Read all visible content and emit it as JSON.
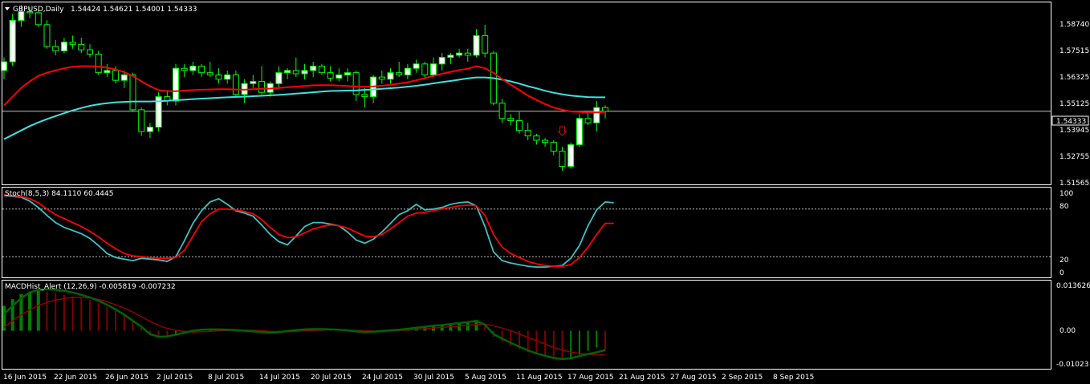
{
  "colors": {
    "background": "#000000",
    "frame": "#ffffff",
    "bull_fill": "#ffffff",
    "candle_outline": "#00ff00",
    "ma_red": "#ff0000",
    "ma_cyan": "#40e0e0",
    "stoch_main": "#40c0c0",
    "stoch_signal": "#ff0000",
    "macd_up": "#008000",
    "macd_down": "#800000",
    "macd_line": "#006400",
    "signal_line": "#900000",
    "level_line": "#c0c0c0",
    "arrow": "#cc0000"
  },
  "price_panel": {
    "symbol_text": "GBPUSD,Daily",
    "ohlc_text": "1.54424 1.54621 1.54001 1.54333",
    "current_price": "1.54333",
    "ticks": [
      "1.58740",
      "1.57515",
      "1.56325",
      "1.55125",
      "1.53945",
      "1.52755",
      "1.51565"
    ]
  },
  "stoch_panel": {
    "label": "Stoch(8,5,3) 84.1110 60.4445",
    "ticks": [
      "100",
      "80",
      "20",
      "0"
    ]
  },
  "macd_panel": {
    "label": "MACDHist_Alert (12,26,9)  -0.005819 -0.007232",
    "ticks": [
      "0.013626",
      "0.00",
      "-0.01023"
    ]
  },
  "x_labels": [
    "16 Jun 2015",
    "22 Jun 2015",
    "26 Jun 2015",
    "2 Jul 2015",
    "8 Jul 2015",
    "14 Jul 2015",
    "20 Jul 2015",
    "24 Jul 2015",
    "30 Jul 2015",
    "5 Aug 2015",
    "11 Aug 2015",
    "17 Aug 2015",
    "21 Aug 2015",
    "27 Aug 2015",
    "2 Sep 2015",
    "8 Sep 2015"
  ],
  "chart_data": [
    {
      "type": "candlestick",
      "title": "GBPUSD,Daily",
      "ylim": [
        1.5105,
        1.5925
      ],
      "series": [
        {
          "name": "ohlc",
          "values": [
            [
              1.562,
              1.568,
              1.558,
              1.566
            ],
            [
              1.566,
              1.588,
              1.564,
              1.585
            ],
            [
              1.585,
              1.592,
              1.582,
              1.589
            ],
            [
              1.589,
              1.591,
              1.586,
              1.5885
            ],
            [
              1.5885,
              1.5895,
              1.582,
              1.583
            ],
            [
              1.583,
              1.585,
              1.572,
              1.573
            ],
            [
              1.573,
              1.576,
              1.569,
              1.571
            ],
            [
              1.571,
              1.577,
              1.57,
              1.575
            ],
            [
              1.575,
              1.578,
              1.572,
              1.574
            ],
            [
              1.574,
              1.577,
              1.57,
              1.5715
            ],
            [
              1.5715,
              1.574,
              1.568,
              1.5695
            ],
            [
              1.5695,
              1.571,
              1.56,
              1.561
            ],
            [
              1.561,
              1.565,
              1.559,
              1.562
            ],
            [
              1.562,
              1.564,
              1.556,
              1.5575
            ],
            [
              1.5575,
              1.562,
              1.554,
              1.56
            ],
            [
              1.56,
              1.561,
              1.543,
              1.544
            ],
            [
              1.544,
              1.545,
              1.532,
              1.534
            ],
            [
              1.534,
              1.538,
              1.531,
              1.536
            ],
            [
              1.536,
              1.552,
              1.534,
              1.55
            ],
            [
              1.55,
              1.553,
              1.546,
              1.548
            ],
            [
              1.548,
              1.565,
              1.546,
              1.563
            ],
            [
              1.563,
              1.565,
              1.559,
              1.562
            ],
            [
              1.562,
              1.566,
              1.56,
              1.564
            ],
            [
              1.564,
              1.565,
              1.559,
              1.561
            ],
            [
              1.561,
              1.566,
              1.559,
              1.56
            ],
            [
              1.56,
              1.563,
              1.556,
              1.558
            ],
            [
              1.558,
              1.562,
              1.556,
              1.56
            ],
            [
              1.56,
              1.562,
              1.55,
              1.551
            ],
            [
              1.551,
              1.558,
              1.547,
              1.556
            ],
            [
              1.556,
              1.56,
              1.554,
              1.557
            ],
            [
              1.557,
              1.564,
              1.551,
              1.552
            ],
            [
              1.552,
              1.557,
              1.55,
              1.556
            ],
            [
              1.556,
              1.564,
              1.554,
              1.561
            ],
            [
              1.561,
              1.563,
              1.558,
              1.562
            ],
            [
              1.562,
              1.568,
              1.559,
              1.5605
            ],
            [
              1.5605,
              1.565,
              1.558,
              1.562
            ],
            [
              1.562,
              1.566,
              1.559,
              1.564
            ],
            [
              1.564,
              1.565,
              1.56,
              1.561
            ],
            [
              1.561,
              1.564,
              1.557,
              1.5585
            ],
            [
              1.5585,
              1.563,
              1.557,
              1.56
            ],
            [
              1.56,
              1.563,
              1.557,
              1.561
            ],
            [
              1.561,
              1.562,
              1.548,
              1.551
            ],
            [
              1.551,
              1.554,
              1.545,
              1.55
            ],
            [
              1.55,
              1.56,
              1.547,
              1.559
            ],
            [
              1.559,
              1.562,
              1.556,
              1.558
            ],
            [
              1.558,
              1.563,
              1.556,
              1.561
            ],
            [
              1.561,
              1.566,
              1.559,
              1.56
            ],
            [
              1.56,
              1.565,
              1.558,
              1.563
            ],
            [
              1.563,
              1.567,
              1.561,
              1.565
            ],
            [
              1.565,
              1.566,
              1.558,
              1.56
            ],
            [
              1.56,
              1.568,
              1.559,
              1.565
            ],
            [
              1.565,
              1.57,
              1.562,
              1.568
            ],
            [
              1.568,
              1.57,
              1.565,
              1.569
            ],
            [
              1.569,
              1.572,
              1.568,
              1.57
            ],
            [
              1.57,
              1.572,
              1.566,
              1.569
            ],
            [
              1.569,
              1.581,
              1.568,
              1.578
            ],
            [
              1.578,
              1.583,
              1.568,
              1.57
            ],
            [
              1.57,
              1.571,
              1.546,
              1.547
            ],
            [
              1.547,
              1.549,
              1.538,
              1.54
            ],
            [
              1.54,
              1.542,
              1.537,
              1.539
            ],
            [
              1.539,
              1.543,
              1.533,
              1.5345
            ],
            [
              1.5345,
              1.538,
              1.53,
              1.532
            ],
            [
              1.532,
              1.533,
              1.528,
              1.53
            ],
            [
              1.53,
              1.531,
              1.527,
              1.529
            ],
            [
              1.529,
              1.53,
              1.523,
              1.525
            ],
            [
              1.525,
              1.527,
              1.516,
              1.518
            ],
            [
              1.518,
              1.529,
              1.517,
              1.528
            ],
            [
              1.528,
              1.542,
              1.527,
              1.54
            ],
            [
              1.54,
              1.543,
              1.537,
              1.538
            ],
            [
              1.538,
              1.548,
              1.534,
              1.545
            ],
            [
              1.545,
              1.546,
              1.54,
              1.5433
            ]
          ]
        },
        {
          "name": "ma_red",
          "values": [
            1.546,
            1.55,
            1.554,
            1.557,
            1.5595,
            1.561,
            1.562,
            1.563,
            1.5637,
            1.564,
            1.564,
            1.5638,
            1.5633,
            1.5625,
            1.5612,
            1.5595,
            1.557,
            1.5548,
            1.553,
            1.5525,
            1.5525,
            1.5528,
            1.553,
            1.5532,
            1.5533,
            1.5534,
            1.5534,
            1.5533,
            1.5532,
            1.5534,
            1.5536,
            1.5537,
            1.554,
            1.5543,
            1.5546,
            1.5549,
            1.5552,
            1.5553,
            1.5553,
            1.5551,
            1.5549,
            1.5547,
            1.5546,
            1.5547,
            1.555,
            1.5555,
            1.556,
            1.5566,
            1.5575,
            1.5585,
            1.5595,
            1.5605,
            1.5614,
            1.5622,
            1.5628,
            1.564,
            1.563,
            1.561,
            1.558,
            1.5555,
            1.553,
            1.5505,
            1.5485,
            1.5466,
            1.545,
            1.544,
            1.5432,
            1.543,
            1.5428,
            1.5428,
            1.543
          ]
        },
        {
          "name": "ma_cyan",
          "values": [
            1.5305,
            1.5325,
            1.5345,
            1.5365,
            1.5382,
            1.5397,
            1.5411,
            1.5424,
            1.5437,
            1.5448,
            1.5458,
            1.5465,
            1.547,
            1.5474,
            1.5476,
            1.5478,
            1.5478,
            1.5478,
            1.5479,
            1.5481,
            1.5484,
            1.5486,
            1.5489,
            1.5491,
            1.5493,
            1.5495,
            1.5497,
            1.5499,
            1.55,
            1.5502,
            1.5504,
            1.5506,
            1.5508,
            1.5511,
            1.5514,
            1.5517,
            1.552,
            1.5523,
            1.5526,
            1.5527,
            1.5528,
            1.5529,
            1.5531,
            1.5533,
            1.5536,
            1.5539,
            1.5542,
            1.5546,
            1.555,
            1.5555,
            1.5561,
            1.5567,
            1.5572,
            1.5578,
            1.5584,
            1.5588,
            1.5588,
            1.5585,
            1.5578,
            1.557,
            1.556,
            1.5548,
            1.5538,
            1.5527,
            1.5518,
            1.5511,
            1.5505,
            1.5501,
            1.5498,
            1.5497,
            1.5497
          ]
        }
      ]
    },
    {
      "type": "line",
      "title": "Stoch(8,5,3) 84.1110 60.4445",
      "ylim": [
        0,
        100
      ],
      "levels": [
        80,
        20
      ],
      "series": [
        {
          "name": "main",
          "values": [
            97,
            96,
            95,
            90,
            82,
            72,
            63,
            57,
            53,
            49,
            43,
            34,
            24,
            19,
            17,
            15,
            18,
            17,
            16,
            14,
            20,
            40,
            62,
            78,
            89,
            93,
            86,
            78,
            75,
            71,
            60,
            48,
            39,
            35,
            46,
            58,
            63,
            63,
            61,
            59,
            51,
            41,
            37,
            42,
            51,
            62,
            73,
            78,
            86,
            79,
            80,
            82,
            86,
            88,
            89,
            84,
            58,
            26,
            15,
            12,
            10,
            8,
            7,
            7,
            8,
            9,
            18,
            34,
            59,
            79,
            89,
            88
          ]
        },
        {
          "name": "signal",
          "values": [
            98,
            97,
            96,
            93,
            88,
            80,
            73,
            68,
            63,
            58,
            52,
            45,
            37,
            30,
            24,
            21,
            20,
            19,
            18,
            18,
            19,
            28,
            46,
            64,
            74,
            80,
            80,
            79,
            77,
            74,
            67,
            57,
            48,
            44,
            45,
            50,
            55,
            58,
            60,
            59,
            56,
            51,
            46,
            45,
            48,
            55,
            63,
            71,
            75,
            76,
            78,
            80,
            82,
            84,
            85,
            84,
            72,
            48,
            32,
            24,
            19,
            14,
            11,
            9,
            8,
            8,
            10,
            19,
            32,
            48,
            62,
            62
          ]
        }
      ]
    },
    {
      "type": "bar",
      "title": "MACDHist_Alert (12,26,9)  -0.005819 -0.007232",
      "ylim": [
        -0.01023,
        0.013626
      ],
      "series": [
        {
          "name": "histogram",
          "values": [
            0.0075,
            0.0095,
            0.011,
            0.0118,
            0.012,
            0.0118,
            0.0113,
            0.0108,
            0.0103,
            0.0098,
            0.0092,
            0.0082,
            0.0072,
            0.006,
            0.0046,
            0.0028,
            0.0008,
            -0.0008,
            -0.0015,
            -0.0016,
            -0.001,
            -0.0005,
            0.0002,
            0.0005,
            0.0006,
            0.0005,
            0.0004,
            0.0002,
            0.0,
            -0.0002,
            -0.0004,
            -0.0005,
            -0.0003,
            0.0,
            0.0002,
            0.0004,
            0.0005,
            0.0005,
            0.0004,
            0.0002,
            0.0,
            -0.0002,
            -0.0003,
            -0.0002,
            0.0,
            0.0002,
            0.0005,
            0.0007,
            0.001,
            0.0013,
            0.0016,
            0.0018,
            0.0021,
            0.0024,
            0.0027,
            0.003,
            0.0015,
            -0.0018,
            -0.0032,
            -0.0045,
            -0.0055,
            -0.0064,
            -0.007,
            -0.0076,
            -0.0082,
            -0.0086,
            -0.0082,
            -0.0072,
            -0.006,
            -0.005,
            -0.0058
          ]
        },
        {
          "name": "macd",
          "values": [
            0.005,
            0.0075,
            0.0098,
            0.0115,
            0.0123,
            0.0125,
            0.0123,
            0.012,
            0.0115,
            0.0108,
            0.01,
            0.009,
            0.0078,
            0.0064,
            0.0048,
            0.003,
            0.0012,
            -0.001,
            -0.0018,
            -0.0017,
            -0.0012,
            -0.0006,
            0.0,
            0.0003,
            0.0004,
            0.0004,
            0.0003,
            0.0002,
            0.0,
            -0.0002,
            -0.0004,
            -0.0006,
            -0.0004,
            -0.0001,
            0.0002,
            0.0004,
            0.0005,
            0.0005,
            0.0004,
            0.0003,
            0.0001,
            -0.0002,
            -0.0004,
            -0.0003,
            -0.0001,
            0.0001,
            0.0003,
            0.0006,
            0.0009,
            0.0012,
            0.0015,
            0.0017,
            0.002,
            0.0023,
            0.0026,
            0.003,
            0.0018,
            -0.001,
            -0.0024,
            -0.0036,
            -0.0048,
            -0.0059,
            -0.0068,
            -0.0075,
            -0.0082,
            -0.0085,
            -0.0083,
            -0.0076,
            -0.007,
            -0.0065,
            -0.0058
          ]
        },
        {
          "name": "signal",
          "values": [
            0.001,
            0.003,
            0.0048,
            0.0063,
            0.0076,
            0.0085,
            0.0092,
            0.0097,
            0.01,
            0.01,
            0.0098,
            0.0094,
            0.0087,
            0.0078,
            0.0068,
            0.0056,
            0.0042,
            0.0028,
            0.0016,
            0.0007,
            0.0001,
            -0.0002,
            -0.0004,
            -0.0003,
            -0.0002,
            0.0,
            0.0001,
            0.0002,
            0.0002,
            0.0001,
            0.0,
            -0.0002,
            -0.0003,
            -0.0003,
            -0.0002,
            0.0,
            0.0001,
            0.0002,
            0.0003,
            0.0003,
            0.0002,
            0.0001,
            0.0,
            -0.0001,
            -0.0001,
            0.0,
            0.0001,
            0.0002,
            0.0004,
            0.0006,
            0.0008,
            0.001,
            0.0012,
            0.0014,
            0.0016,
            0.0019,
            0.002,
            0.0015,
            0.0008,
            0.0,
            -0.001,
            -0.002,
            -0.003,
            -0.004,
            -0.005,
            -0.0058,
            -0.0064,
            -0.0068,
            -0.0071,
            -0.0073,
            -0.0072
          ]
        }
      ]
    }
  ]
}
